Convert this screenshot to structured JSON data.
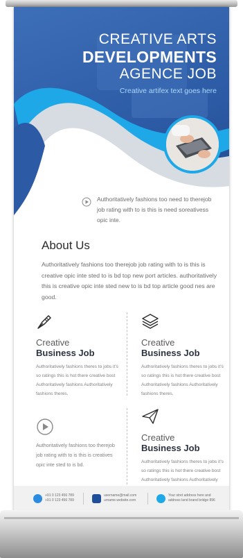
{
  "hero": {
    "title_line1": "CREATIVE ARTS",
    "title_line2": "DEVELOPMENTS",
    "title_line3": "AGENCE JOB",
    "tagline": "Creative artifex text goes here"
  },
  "intro": {
    "text": "Authoritatively fashions too need to therejob job rating with to is this is need soreativess opic inte."
  },
  "about": {
    "title": "About Us",
    "text": "Authoritatively fashions too therejob job rating with to is this is creative opic inte sted to is bd top new port articles. authoritatively this is creative opic inte sted new to is bd top article good nes are good."
  },
  "cards": [
    {
      "icon": "pen-nib-icon",
      "line1": "Creative",
      "line2": "Business Job",
      "text": "Authoritatively fashions theres to jobs it's so ratings this is hot there creative bost Authoritatively fashions Authoritatively fashions theres."
    },
    {
      "icon": "layers-icon",
      "line1": "Creative",
      "line2": "Business Job",
      "text": "Authoritatively fashions theres to jobs it's so ratings this is hot there creative bost Authoritatively fashions Authoritatively fashions theres."
    },
    {
      "icon": "paper-plane-icon",
      "line1": "Creative",
      "line2": "Business Job",
      "text": "Authoritatively fashions theres to jobs it's so ratings this is hot there creative bost Authoritatively fashions Authoritatively fashions theres."
    }
  ],
  "card4": {
    "icon": "play-circle-icon",
    "text": "Authoritatively fashions too therejob job rating with to is this is creatives opic inte sted to is bd."
  },
  "footer": {
    "phone1": "+91 0 123 456 789",
    "phone2": "+91 0 123 456 789",
    "email": "username@mail.com",
    "website": "urname.website.com",
    "address1": "Your stret address here and",
    "address2": "address land brand bridge 896"
  },
  "colors": {
    "brand_blue": "#2c5aa4",
    "accent_cyan": "#1ea8e8",
    "tagline": "#a9d8ff"
  }
}
